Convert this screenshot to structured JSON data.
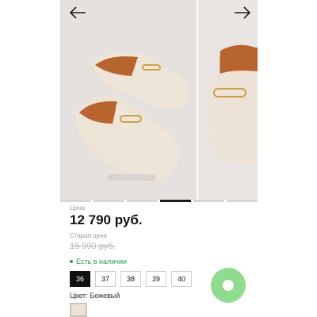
{
  "gallery": {
    "prev_icon": "arrow-left-icon",
    "next_icon": "arrow-right-icon",
    "slide_count": 6,
    "active_slide": 3
  },
  "product": {
    "price_label": "Цена",
    "price": "12 790 руб.",
    "old_price_label": "Старая цена",
    "old_price": "15 990 руб.",
    "stock": "Есть в наличии",
    "sizes": [
      "36",
      "37",
      "38",
      "39",
      "40"
    ],
    "selected_size": "36",
    "color_label": "Цвет: Бежевый"
  },
  "colors": {
    "accent_green": "#2e9e4f",
    "chat_button": "#8fdc8f",
    "swatch": "#ebe3d7"
  },
  "chat": {
    "icon": "chat-icon"
  }
}
